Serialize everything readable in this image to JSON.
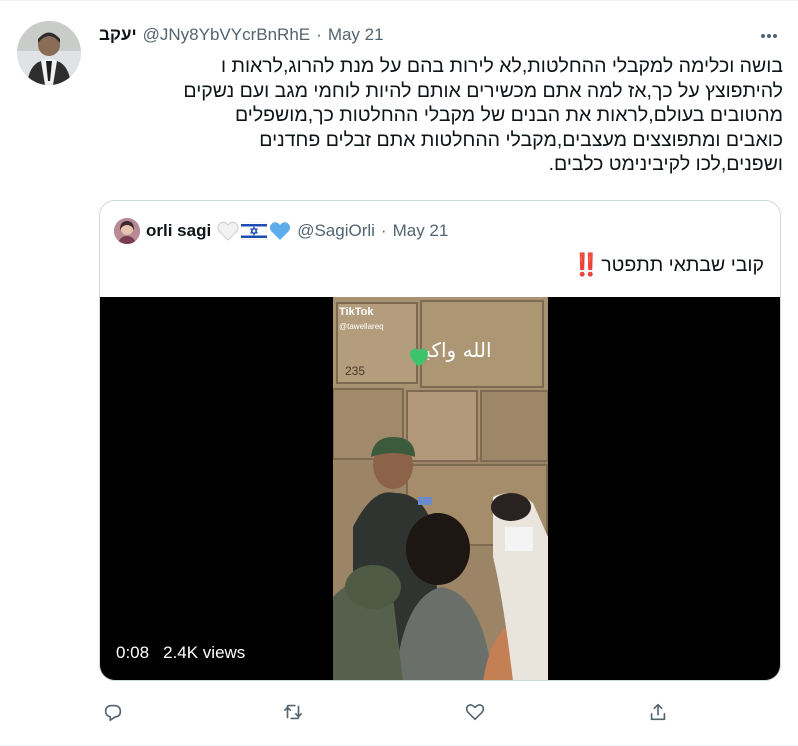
{
  "tweet": {
    "display_name": "יעקב",
    "handle": "@JNy8YbVYcrBnRhE",
    "separator": "·",
    "date": "May 21",
    "text": "בושה וכלימה למקבלי ההחלטות,לא לירות בהם על מנת להרוג,לראות ו\nלהיתפוצץ על כך,אז למה אתם מכשירים אותם להיות לוחמי מגב ועם נשקים\nמהטובים בעולם,לראות את הבנים של מקבלי ההחלטות כך,מושפלים\nכואבים ומתפוצצים מעצבים,מקבלי ההחלטות אתם זבלים פחדנים\nושפנים,לכו לקיבינימט כלבים."
  },
  "quote": {
    "display_name": "orli sagi",
    "handle": "@SagiOrli",
    "separator": "·",
    "date": "May 21",
    "text": "קובי שבתאי תתפטר",
    "text_emoji": "‼️"
  },
  "video": {
    "duration": "0:08",
    "views": "2.4K views",
    "watermark": "TikTok",
    "watermark_user": "@tawellareq",
    "overlay_text": "الله واكبر",
    "wall_number": "235"
  },
  "icons": {
    "more": "more-icon",
    "reply": "reply-icon",
    "retweet": "retweet-icon",
    "like": "like-icon",
    "share": "share-icon"
  },
  "colors": {
    "text": "#0f1419",
    "secondary": "#536471",
    "border": "#cfd9de",
    "icon": "#536471"
  }
}
